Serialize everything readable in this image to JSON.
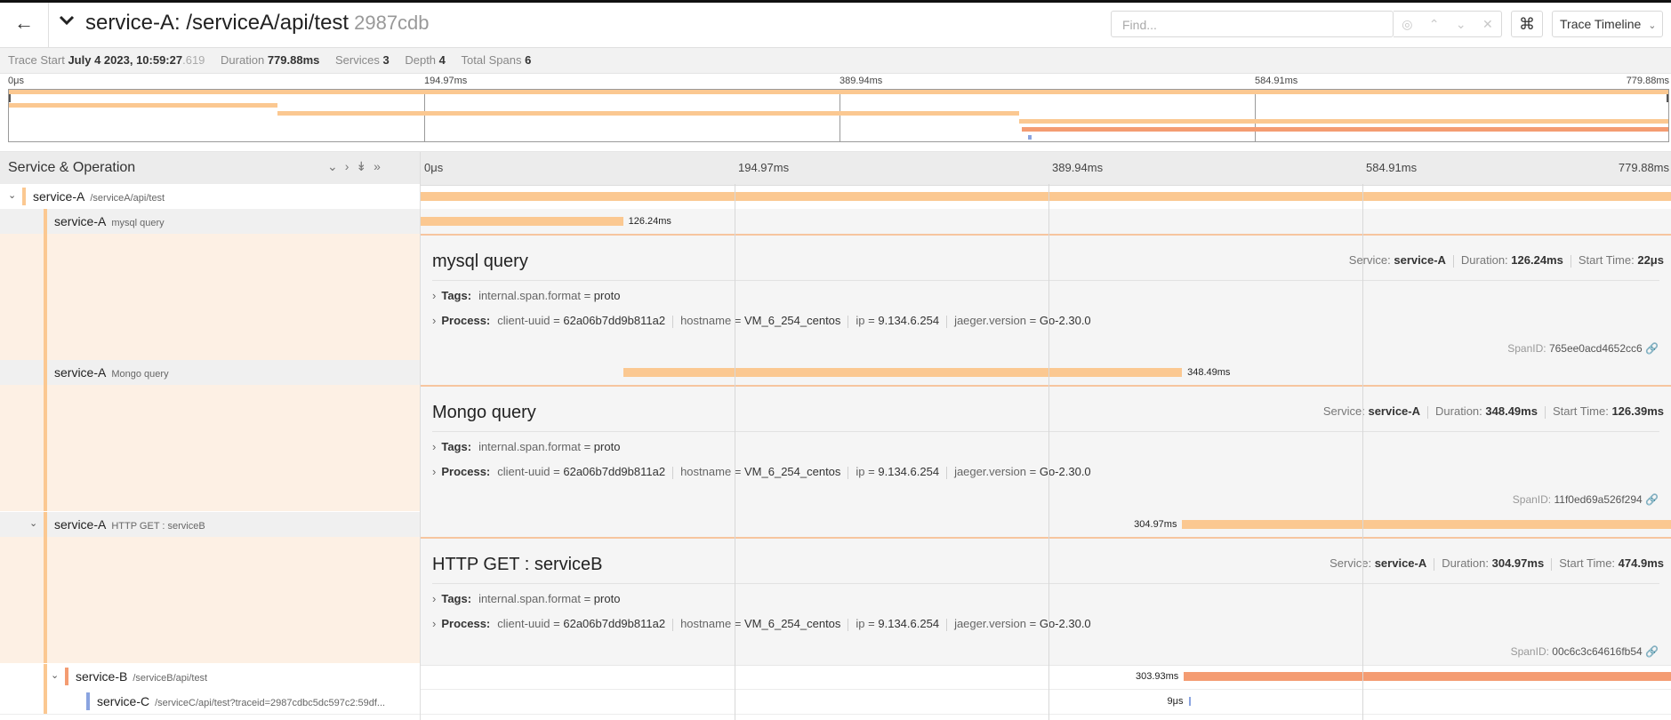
{
  "header": {
    "back_icon": "arrow-left-icon",
    "collapse_icon": "chevron-down-icon",
    "title": "service-A: /serviceA/api/test",
    "trace_id": "2987cdb",
    "find_placeholder": "Find...",
    "keyboard_icon": "command-key-icon",
    "view_select": "Trace Timeline"
  },
  "meta": {
    "trace_start_label": "Trace Start",
    "trace_start_value": "July 4 2023, 10:59:27",
    "trace_start_ms": ".619",
    "duration_label": "Duration",
    "duration_value": "779.88ms",
    "services_label": "Services",
    "services_value": "3",
    "depth_label": "Depth",
    "depth_value": "4",
    "total_spans_label": "Total Spans",
    "total_spans_value": "6"
  },
  "ticks": [
    "0μs",
    "194.97ms",
    "389.94ms",
    "584.91ms",
    "779.88ms"
  ],
  "columns": {
    "service_operation": "Service & Operation"
  },
  "colors": {
    "service_A": "#fbc891",
    "service_B": "#f49c72",
    "service_C": "#8aa4e0",
    "detail_accent": "#f7c59f"
  },
  "spans": [
    {
      "service": "service-A",
      "operation": "/serviceA/api/test",
      "start_ms": 0,
      "duration_ms": 779.88,
      "label": ""
    },
    {
      "service": "service-A",
      "operation": "mysql query",
      "start_ms": 0.022,
      "duration_ms": 126.24,
      "label": "126.24ms"
    },
    {
      "service": "service-A",
      "operation": "Mongo query",
      "start_ms": 126.39,
      "duration_ms": 348.49,
      "label": "348.49ms"
    },
    {
      "service": "service-A",
      "operation": "HTTP GET : serviceB",
      "start_ms": 474.9,
      "duration_ms": 304.97,
      "label": "304.97ms"
    },
    {
      "service": "service-B",
      "operation": "/serviceB/api/test",
      "start_ms": 475.9,
      "duration_ms": 303.93,
      "label": "303.93ms"
    },
    {
      "service": "service-C",
      "operation": "/serviceC/api/test?traceid=2987cdbc5dc597c2:59df...",
      "start_ms": 479.0,
      "duration_ms": 0.009,
      "label": "9μs"
    }
  ],
  "details": [
    {
      "title": "mysql query",
      "service_label": "Service:",
      "service": "service-A",
      "duration_label": "Duration:",
      "duration": "126.24ms",
      "start_label": "Start Time:",
      "start": "22μs",
      "tags_label": "Tags:",
      "tag_key": "internal.span.format",
      "tag_value": "proto",
      "process_label": "Process:",
      "p1k": "client-uuid",
      "p1v": "62a06b7dd9b811a2",
      "p2k": "hostname",
      "p2v": "VM_6_254_centos",
      "p3k": "ip",
      "p3v": "9.134.6.254",
      "p4k": "jaeger.version",
      "p4v": "Go-2.30.0",
      "spanid_label": "SpanID:",
      "spanid": "765ee0acd4652cc6"
    },
    {
      "title": "Mongo query",
      "service_label": "Service:",
      "service": "service-A",
      "duration_label": "Duration:",
      "duration": "348.49ms",
      "start_label": "Start Time:",
      "start": "126.39ms",
      "tags_label": "Tags:",
      "tag_key": "internal.span.format",
      "tag_value": "proto",
      "process_label": "Process:",
      "p1k": "client-uuid",
      "p1v": "62a06b7dd9b811a2",
      "p2k": "hostname",
      "p2v": "VM_6_254_centos",
      "p3k": "ip",
      "p3v": "9.134.6.254",
      "p4k": "jaeger.version",
      "p4v": "Go-2.30.0",
      "spanid_label": "SpanID:",
      "spanid": "11f0ed69a526f294"
    },
    {
      "title": "HTTP GET : serviceB",
      "service_label": "Service:",
      "service": "service-A",
      "duration_label": "Duration:",
      "duration": "304.97ms",
      "start_label": "Start Time:",
      "start": "474.9ms",
      "tags_label": "Tags:",
      "tag_key": "internal.span.format",
      "tag_value": "proto",
      "process_label": "Process:",
      "p1k": "client-uuid",
      "p1v": "62a06b7dd9b811a2",
      "p2k": "hostname",
      "p2v": "VM_6_254_centos",
      "p3k": "ip",
      "p3v": "9.134.6.254",
      "p4k": "jaeger.version",
      "p4v": "Go-2.30.0",
      "spanid_label": "SpanID:",
      "spanid": "00c6c3c64616fb54"
    }
  ]
}
